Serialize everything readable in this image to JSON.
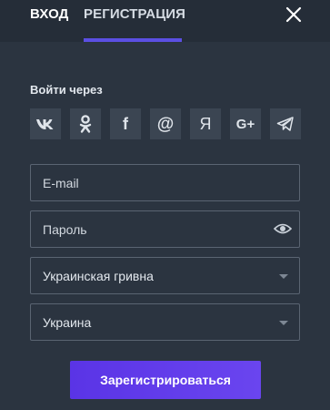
{
  "tabs": {
    "login_label": "ВХОД",
    "register_label": "РЕГИСТРАЦИЯ",
    "active": "register"
  },
  "social": {
    "label": "Войти через",
    "providers": [
      {
        "name": "vk",
        "glyph": "vk-icon"
      },
      {
        "name": "odnoklassniki",
        "glyph": "odnoklassniki-icon"
      },
      {
        "name": "facebook",
        "glyph": "facebook-icon",
        "text": "f"
      },
      {
        "name": "mail",
        "glyph": "at-icon",
        "text": "@"
      },
      {
        "name": "yandex",
        "glyph": "yandex-icon",
        "text": "Я"
      },
      {
        "name": "google-plus",
        "glyph": "google-plus-icon",
        "text": "G+"
      },
      {
        "name": "telegram",
        "glyph": "telegram-icon"
      }
    ]
  },
  "form": {
    "email_placeholder": "E-mail",
    "password_placeholder": "Пароль",
    "currency_value": "Украинская гривна",
    "country_value": "Украина",
    "submit_label": "Зарегистрироваться"
  },
  "colors": {
    "background": "#2b3440",
    "header": "#252d38",
    "accent": "#5b4fe3",
    "social_tile": "#3b4552",
    "field_border": "#5a6472"
  }
}
